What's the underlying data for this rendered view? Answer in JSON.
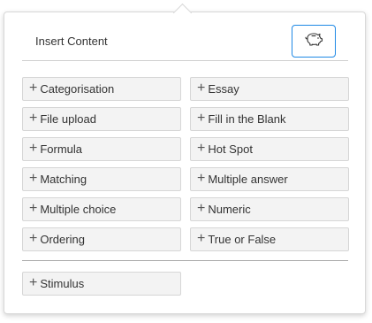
{
  "panel": {
    "title": "Insert Content",
    "piggy_button_icon": "piggy-bank-icon"
  },
  "question_types": [
    {
      "label": "Categorisation"
    },
    {
      "label": "Essay"
    },
    {
      "label": "File upload"
    },
    {
      "label": "Fill in the Blank"
    },
    {
      "label": "Formula"
    },
    {
      "label": "Hot Spot"
    },
    {
      "label": "Matching"
    },
    {
      "label": "Multiple answer"
    },
    {
      "label": "Multiple choice"
    },
    {
      "label": "Numeric"
    },
    {
      "label": "Ordering"
    },
    {
      "label": "True or False"
    }
  ],
  "extra": {
    "stimulus_label": "Stimulus"
  },
  "plus_glyph": "+",
  "colors": {
    "accent": "#1e88e5",
    "button_bg": "#f3f3f3",
    "button_border": "#d6d6d6"
  }
}
